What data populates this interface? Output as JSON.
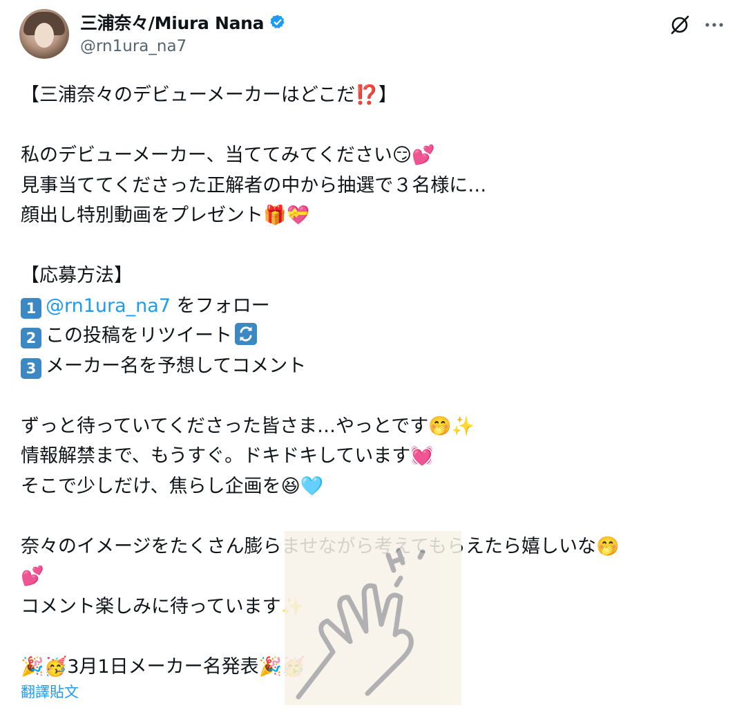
{
  "author": {
    "display_name": "三浦奈々/Miura Nana",
    "handle": "@rn1ura_na7"
  },
  "icons": {
    "avatar": "profile-photo",
    "verified": "verified-badge-icon",
    "grok": "grok-icon",
    "more": "more-options-icon"
  },
  "tweet": {
    "title": "【三浦奈々のデビューメーカーはどこだ⁉️】",
    "para1": [
      "私のデビューメーカー、当ててみてください😏💕",
      "見事当ててくださった正解者の中から抽選で３名様に…",
      "顔出し特別動画をプレゼント🎁💝"
    ],
    "apply_heading": "【応募方法】",
    "step1_number": "1",
    "step1_mention": "@rn1ura_na7",
    "step1_text": " をフォロー",
    "step2_number": "2",
    "step2_text": "この投稿をリツイート",
    "step3_number": "3",
    "step3_text": "メーカー名を予想してコメント",
    "para2": [
      "ずっと待っていてくださった皆さま…やっとです🤭✨",
      "情報解禁まで、もうすぐ。ドキドキしています💓",
      "そこで少しだけ、焦らし企画を😆🩵"
    ],
    "para3": [
      "奈々のイメージをたくさん膨らませながら考えてもらえたら嬉しいな🤭",
      "💕",
      "コメント楽しみに待っています✨"
    ],
    "announce": "🎉🥳3月1日メーカー名発表🎉🥳"
  },
  "translate_label": "翻譯貼文",
  "colors": {
    "link": "#1d9bf0",
    "secondary_text": "#536471",
    "keycap": "#3b88c3"
  }
}
